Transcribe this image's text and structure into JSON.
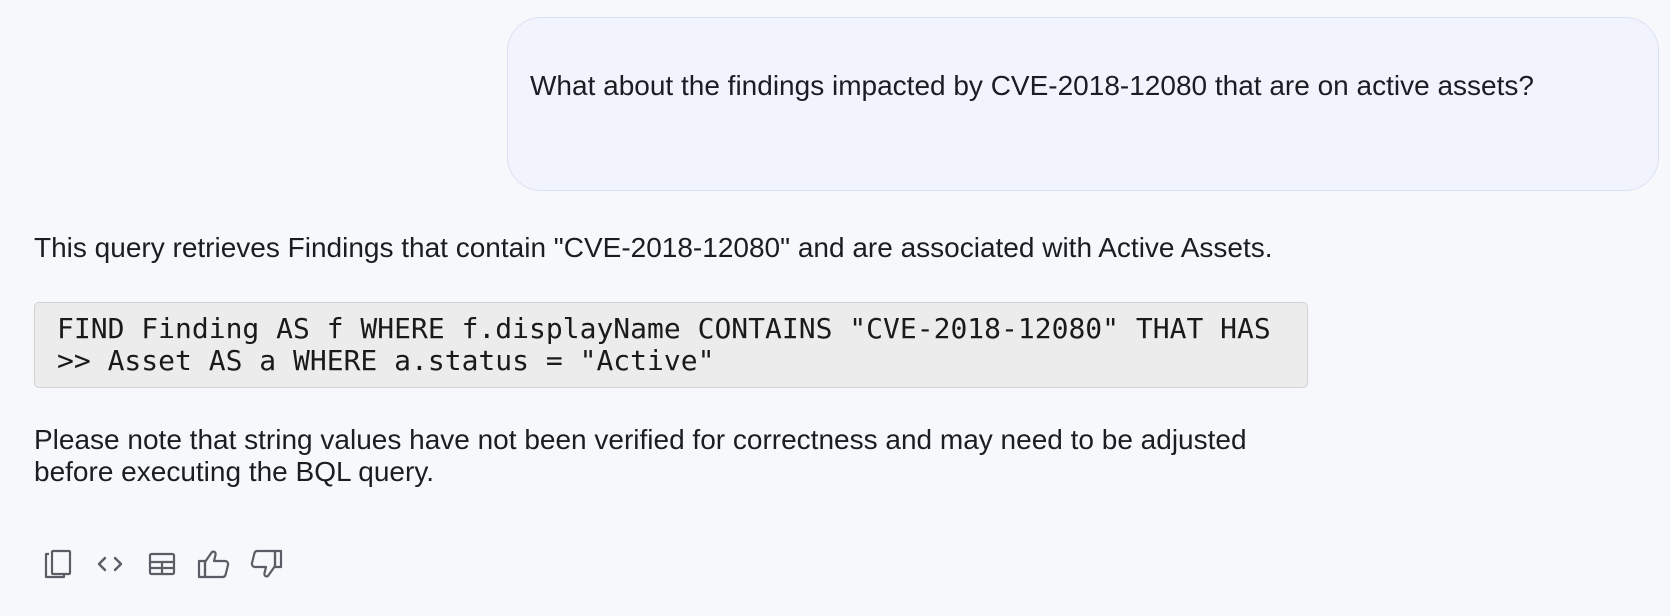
{
  "conversation": {
    "user_message": "What about the findings impacted by CVE-2018-12080 that are on active assets?",
    "assistant": {
      "intro": "This query retrieves Findings that contain \"CVE-2018-12080\" and are associated with Active Assets.",
      "code": "FIND Finding AS f WHERE f.displayName CONTAINS \"CVE-2018-12080\" THAT HAS >> Asset AS a WHERE a.status = \"Active\"",
      "note": "Please note that string values have not been verified for correctness and may need to be adjusted before executing the BQL query."
    }
  },
  "actions": {
    "icons": [
      "copy-icon",
      "code-icon",
      "table-icon",
      "thumbs-up-icon",
      "thumbs-down-icon"
    ]
  },
  "colors": {
    "background": "#f7f8fb",
    "user_bubble": "#f1f4fc",
    "user_bubble_border": "#d9e1f4",
    "code_background": "#ececec",
    "icon": "#5a5d66"
  }
}
